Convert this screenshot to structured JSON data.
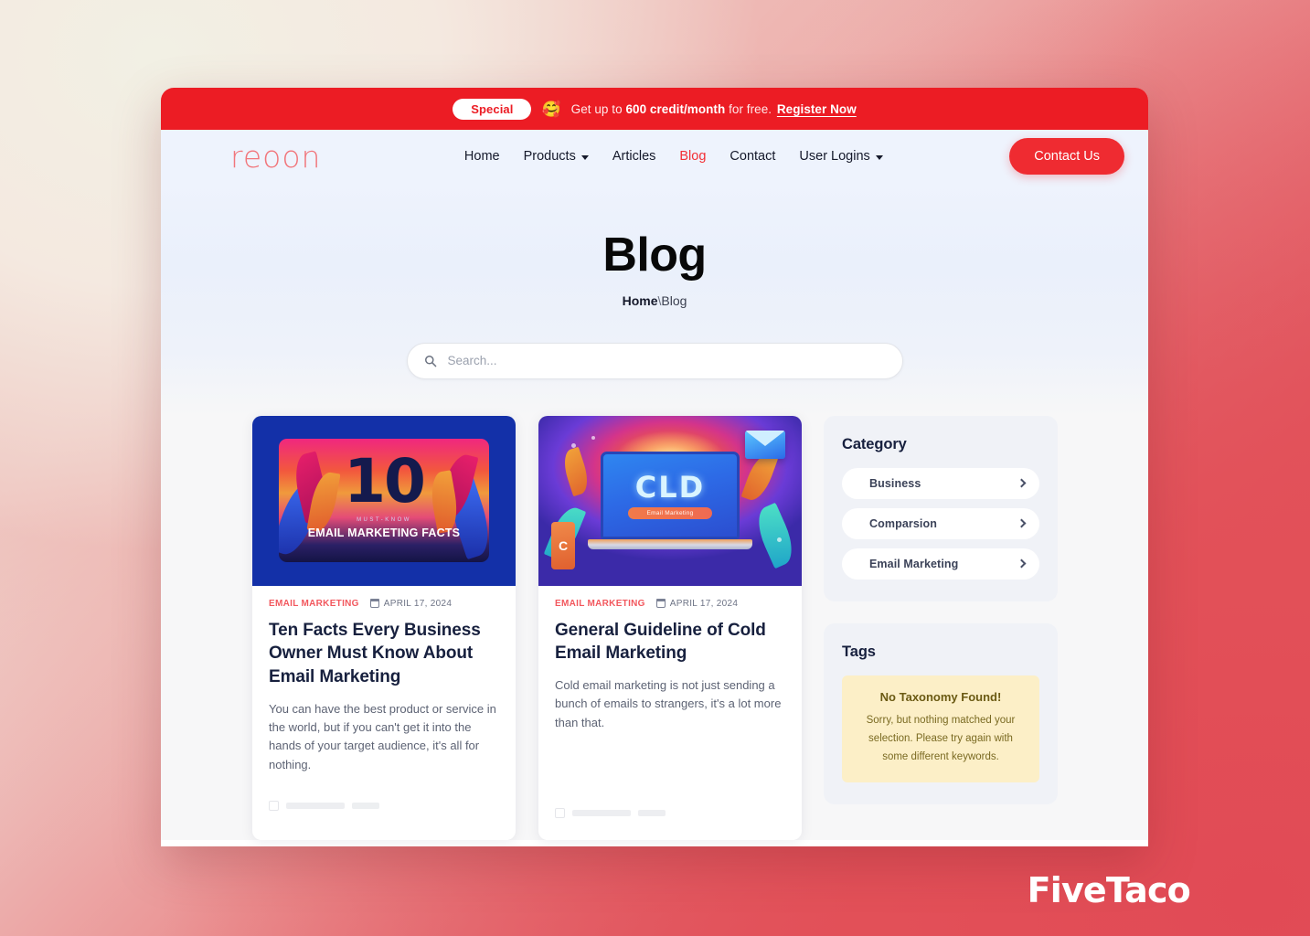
{
  "promo": {
    "badge": "Special",
    "emoji": "🥰",
    "emoji_name": "smiling-face-with-hearts",
    "text_before": "Get up to ",
    "highlight": "600 credit/month",
    "text_after": " for free.",
    "link": "Register Now"
  },
  "nav": {
    "logo": "reoon",
    "items": [
      {
        "label": "Home",
        "has_caret": false,
        "active": false
      },
      {
        "label": "Products",
        "has_caret": true,
        "active": false
      },
      {
        "label": "Articles",
        "has_caret": false,
        "active": false
      },
      {
        "label": "Blog",
        "has_caret": false,
        "active": true
      },
      {
        "label": "Contact",
        "has_caret": false,
        "active": false
      },
      {
        "label": "User Logins",
        "has_caret": true,
        "active": false
      }
    ],
    "cta": "Contact Us"
  },
  "hero": {
    "title": "Blog",
    "breadcrumb_home": "Home",
    "breadcrumb_sep": "\\",
    "breadcrumb_current": "Blog"
  },
  "search": {
    "placeholder": "Search...",
    "value": "",
    "icon": "search-icon"
  },
  "posts": [
    {
      "category": "EMAIL MARKETING",
      "date": "APRIL 17, 2024",
      "title": "Ten Facts Every Business Owner Must Know About Email Marketing",
      "excerpt": "You can have the best product or service in the world, but if you can't get it into the hands of your target audience, it's all for nothing.",
      "thumb": {
        "number": "10",
        "kicker": "MUST-KNOW",
        "caption": "EMAIL MARKETING FACTS"
      }
    },
    {
      "category": "EMAIL MARKETING",
      "date": "APRIL 17, 2024",
      "title": "General Guideline of Cold Email Marketing",
      "excerpt": "Cold email marketing is not just sending a bunch of emails to strangers, it's a lot more than that.",
      "thumb": {
        "screen_text": "CLD",
        "pill_text": "Email Marketing",
        "phone_letter": "C"
      }
    }
  ],
  "sidebar": {
    "category": {
      "title": "Category",
      "items": [
        {
          "label": "Business"
        },
        {
          "label": "Comparsion"
        },
        {
          "label": "Email Marketing"
        }
      ]
    },
    "tags": {
      "title": "Tags",
      "notice_title": "No Taxonomy Found!",
      "notice_body": "Sorry, but nothing matched your selection. Please try again with some different keywords."
    }
  },
  "watermark": "FiveTaco",
  "colors": {
    "brand_red": "#ec1c24",
    "accent_red": "#f32f35",
    "nav_bg": "#eef3fd",
    "panel_bg": "#f0f2f7",
    "notice_bg": "#fcefc7",
    "title_dark": "#17203e"
  }
}
